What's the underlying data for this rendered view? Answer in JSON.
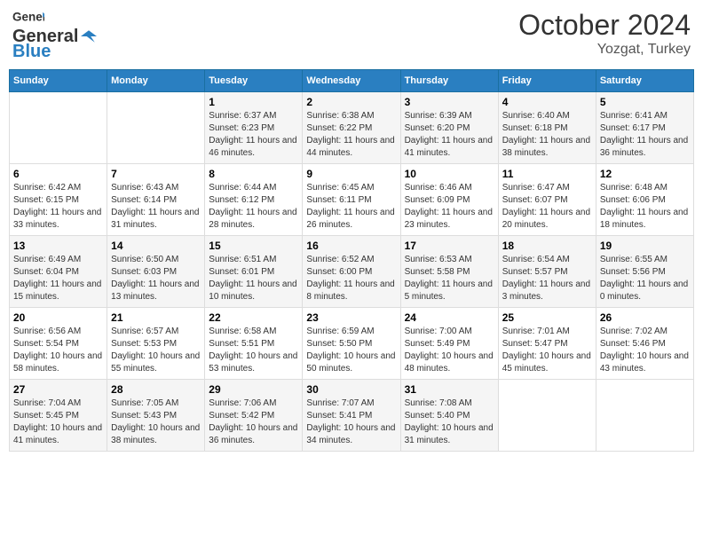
{
  "header": {
    "logo": {
      "general": "General",
      "blue": "Blue"
    },
    "title": "October 2024",
    "location": "Yozgat, Turkey"
  },
  "calendar": {
    "days_of_week": [
      "Sunday",
      "Monday",
      "Tuesday",
      "Wednesday",
      "Thursday",
      "Friday",
      "Saturday"
    ],
    "weeks": [
      [
        {
          "day": "",
          "info": ""
        },
        {
          "day": "",
          "info": ""
        },
        {
          "day": "1",
          "sunrise": "6:37 AM",
          "sunset": "6:23 PM",
          "daylight": "11 hours and 46 minutes."
        },
        {
          "day": "2",
          "sunrise": "6:38 AM",
          "sunset": "6:22 PM",
          "daylight": "11 hours and 44 minutes."
        },
        {
          "day": "3",
          "sunrise": "6:39 AM",
          "sunset": "6:20 PM",
          "daylight": "11 hours and 41 minutes."
        },
        {
          "day": "4",
          "sunrise": "6:40 AM",
          "sunset": "6:18 PM",
          "daylight": "11 hours and 38 minutes."
        },
        {
          "day": "5",
          "sunrise": "6:41 AM",
          "sunset": "6:17 PM",
          "daylight": "11 hours and 36 minutes."
        }
      ],
      [
        {
          "day": "6",
          "sunrise": "6:42 AM",
          "sunset": "6:15 PM",
          "daylight": "11 hours and 33 minutes."
        },
        {
          "day": "7",
          "sunrise": "6:43 AM",
          "sunset": "6:14 PM",
          "daylight": "11 hours and 31 minutes."
        },
        {
          "day": "8",
          "sunrise": "6:44 AM",
          "sunset": "6:12 PM",
          "daylight": "11 hours and 28 minutes."
        },
        {
          "day": "9",
          "sunrise": "6:45 AM",
          "sunset": "6:11 PM",
          "daylight": "11 hours and 26 minutes."
        },
        {
          "day": "10",
          "sunrise": "6:46 AM",
          "sunset": "6:09 PM",
          "daylight": "11 hours and 23 minutes."
        },
        {
          "day": "11",
          "sunrise": "6:47 AM",
          "sunset": "6:07 PM",
          "daylight": "11 hours and 20 minutes."
        },
        {
          "day": "12",
          "sunrise": "6:48 AM",
          "sunset": "6:06 PM",
          "daylight": "11 hours and 18 minutes."
        }
      ],
      [
        {
          "day": "13",
          "sunrise": "6:49 AM",
          "sunset": "6:04 PM",
          "daylight": "11 hours and 15 minutes."
        },
        {
          "day": "14",
          "sunrise": "6:50 AM",
          "sunset": "6:03 PM",
          "daylight": "11 hours and 13 minutes."
        },
        {
          "day": "15",
          "sunrise": "6:51 AM",
          "sunset": "6:01 PM",
          "daylight": "11 hours and 10 minutes."
        },
        {
          "day": "16",
          "sunrise": "6:52 AM",
          "sunset": "6:00 PM",
          "daylight": "11 hours and 8 minutes."
        },
        {
          "day": "17",
          "sunrise": "6:53 AM",
          "sunset": "5:58 PM",
          "daylight": "11 hours and 5 minutes."
        },
        {
          "day": "18",
          "sunrise": "6:54 AM",
          "sunset": "5:57 PM",
          "daylight": "11 hours and 3 minutes."
        },
        {
          "day": "19",
          "sunrise": "6:55 AM",
          "sunset": "5:56 PM",
          "daylight": "11 hours and 0 minutes."
        }
      ],
      [
        {
          "day": "20",
          "sunrise": "6:56 AM",
          "sunset": "5:54 PM",
          "daylight": "10 hours and 58 minutes."
        },
        {
          "day": "21",
          "sunrise": "6:57 AM",
          "sunset": "5:53 PM",
          "daylight": "10 hours and 55 minutes."
        },
        {
          "day": "22",
          "sunrise": "6:58 AM",
          "sunset": "5:51 PM",
          "daylight": "10 hours and 53 minutes."
        },
        {
          "day": "23",
          "sunrise": "6:59 AM",
          "sunset": "5:50 PM",
          "daylight": "10 hours and 50 minutes."
        },
        {
          "day": "24",
          "sunrise": "7:00 AM",
          "sunset": "5:49 PM",
          "daylight": "10 hours and 48 minutes."
        },
        {
          "day": "25",
          "sunrise": "7:01 AM",
          "sunset": "5:47 PM",
          "daylight": "10 hours and 45 minutes."
        },
        {
          "day": "26",
          "sunrise": "7:02 AM",
          "sunset": "5:46 PM",
          "daylight": "10 hours and 43 minutes."
        }
      ],
      [
        {
          "day": "27",
          "sunrise": "7:04 AM",
          "sunset": "5:45 PM",
          "daylight": "10 hours and 41 minutes."
        },
        {
          "day": "28",
          "sunrise": "7:05 AM",
          "sunset": "5:43 PM",
          "daylight": "10 hours and 38 minutes."
        },
        {
          "day": "29",
          "sunrise": "7:06 AM",
          "sunset": "5:42 PM",
          "daylight": "10 hours and 36 minutes."
        },
        {
          "day": "30",
          "sunrise": "7:07 AM",
          "sunset": "5:41 PM",
          "daylight": "10 hours and 34 minutes."
        },
        {
          "day": "31",
          "sunrise": "7:08 AM",
          "sunset": "5:40 PM",
          "daylight": "10 hours and 31 minutes."
        },
        {
          "day": "",
          "info": ""
        },
        {
          "day": "",
          "info": ""
        }
      ]
    ],
    "labels": {
      "sunrise": "Sunrise:",
      "sunset": "Sunset:",
      "daylight": "Daylight:"
    }
  }
}
